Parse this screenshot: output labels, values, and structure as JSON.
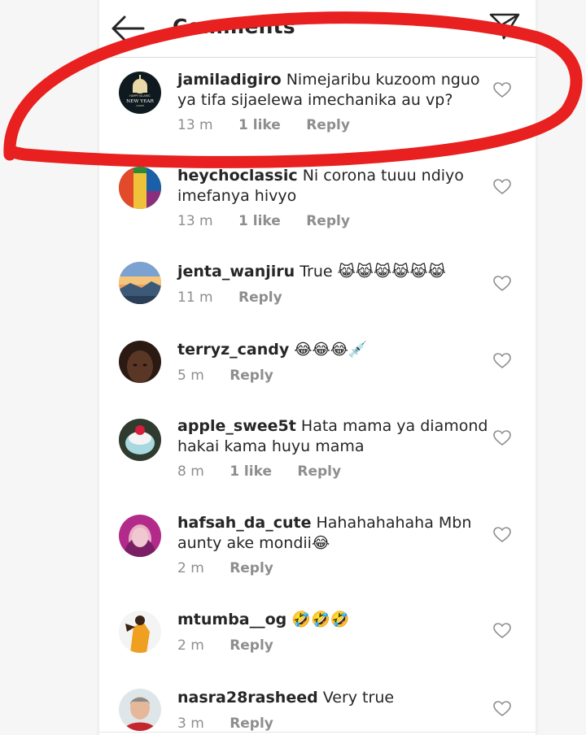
{
  "header": {
    "title": "Comments",
    "back_icon": "arrow-left-icon",
    "share_icon": "paper-plane-icon"
  },
  "comments": [
    {
      "username": "jamiladigiro",
      "text": "Nimejaribu kuzoom nguo",
      "text2": "ya tifa sijaelewa imechanika au vp?",
      "time": "13 m",
      "likes": "1 like",
      "reply": "Reply"
    },
    {
      "username": "heychoclassic",
      "text": "Ni corona tuuu ndiyo",
      "text2": "imefanya hivyo",
      "time": "13 m",
      "likes": "1 like",
      "reply": "Reply"
    },
    {
      "username": "jenta_wanjiru",
      "text": "True 😹😹😹😹😹😹",
      "time": "11 m",
      "reply": "Reply"
    },
    {
      "username": "terryz_candy",
      "text": "😂😂😂💉",
      "time": "5 m",
      "reply": "Reply"
    },
    {
      "username": "apple_swee5t",
      "text": "Hata mama ya diamond",
      "text2": "hakai kama huyu mama",
      "time": "8 m",
      "likes": "1 like",
      "reply": "Reply"
    },
    {
      "username": "hafsah_da_cute",
      "text": "Hahahahahaha Mbn",
      "text2": "aunty ake mondii😂",
      "time": "2 m",
      "reply": "Reply"
    },
    {
      "username": "mtumba__og",
      "text": "🤣🤣🤣",
      "time": "2 m",
      "reply": "Reply"
    },
    {
      "username": "nasra28rasheed",
      "text": "Very true",
      "time": "3 m",
      "reply": "Reply"
    }
  ],
  "first_avatar_caption": {
    "line1": "HAPPY ISLAMIC",
    "line2": "NEW YEAR",
    "line3": "1442H"
  },
  "colors": {
    "annotation": "#e8201f",
    "meta": "#8e8e8e",
    "text": "#262626"
  }
}
